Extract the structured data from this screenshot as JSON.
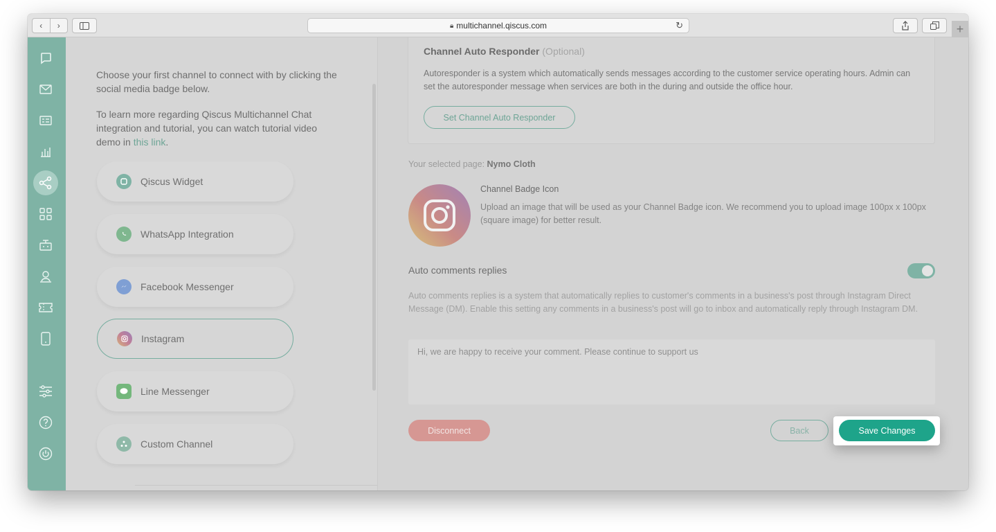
{
  "browser": {
    "url": "multichannel.qiscus.com",
    "back_glyph": "‹",
    "forward_glyph": "›",
    "new_tab_glyph": "+"
  },
  "sidebar": {
    "items": [
      {
        "icon": "chat-bubble-icon"
      },
      {
        "icon": "mail-icon"
      },
      {
        "icon": "contact-card-icon"
      },
      {
        "icon": "analytics-chart-icon"
      },
      {
        "icon": "channels-share-icon",
        "active": true
      },
      {
        "icon": "apps-grid-icon"
      },
      {
        "icon": "bot-icon"
      },
      {
        "icon": "agent-icon"
      },
      {
        "icon": "ticket-icon"
      },
      {
        "icon": "mobile-icon"
      },
      {
        "icon": "settings-sliders-icon"
      },
      {
        "icon": "help-icon"
      },
      {
        "icon": "power-icon"
      }
    ]
  },
  "left": {
    "intro_1": "Choose your first channel to connect with by clicking the social media badge below.",
    "intro_2_prefix": "To learn more regarding Qiscus Multichannel Chat integration and tutorial, you can watch tutorial video demo in ",
    "intro_2_link": "this link",
    "intro_2_suffix": ".",
    "channels": [
      {
        "label": "Qiscus Widget",
        "icon": "qiscus-widget-icon",
        "color": "#7fb3a5"
      },
      {
        "label": "WhatsApp Integration",
        "icon": "whatsapp-icon",
        "color": "#7fb78f"
      },
      {
        "label": "Facebook Messenger",
        "icon": "messenger-icon",
        "color": "#7f9fd4"
      },
      {
        "label": "Instagram",
        "icon": "instagram-icon",
        "color": "#c98aa0",
        "active": true
      },
      {
        "label": "Line Messenger",
        "icon": "line-icon",
        "color": "#74b77c"
      },
      {
        "label": "Custom Channel",
        "icon": "custom-channel-icon",
        "color": "#8fb9a8"
      }
    ]
  },
  "right": {
    "auto_responder": {
      "title": "Channel Auto Responder",
      "optional": "(Optional)",
      "desc": "Autoresponder is a system which automatically sends messages according to the customer service operating hours. Admin can set the autoresponder message when services are both in the during and outside the office hour.",
      "button": "Set Channel Auto Responder"
    },
    "selected_page_label": "Your selected page:",
    "selected_page_value": "Nymo Cloth",
    "badge": {
      "title": "Channel Badge Icon",
      "desc": "Upload an image that will be used as your Channel Badge icon. We recommend you to upload image 100px x 100px (square image) for better result."
    },
    "auto_comments": {
      "label": "Auto comments replies",
      "enabled": true,
      "desc": "Auto comments replies is a system that automatically replies to customer's comments in a business's post through Instagram Direct Message (DM). Enable this setting any comments in a business's post will go to inbox and automatically reply through Instagram DM.",
      "message": "Hi, we are happy to receive your comment. Please continue to support us"
    },
    "buttons": {
      "disconnect": "Disconnect",
      "back": "Back",
      "save": "Save Changes"
    }
  },
  "colors": {
    "brand": "#1ea48a",
    "sidebar": "#7fb3a5",
    "danger": "#d69793"
  }
}
